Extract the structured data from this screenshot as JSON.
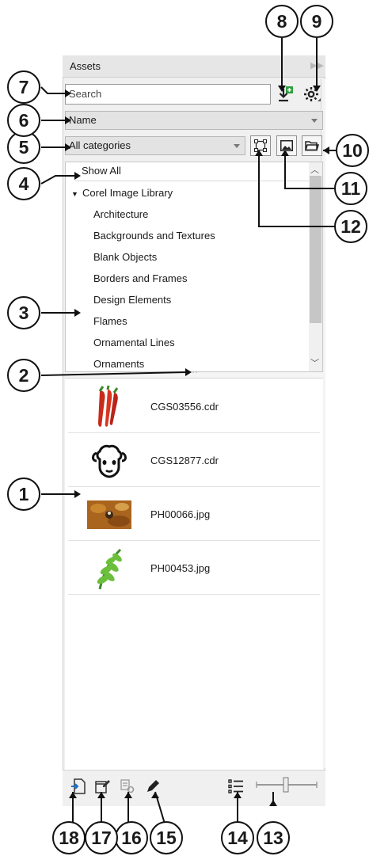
{
  "panel": {
    "title": "Assets",
    "search_placeholder": "Search",
    "sort_value": "Name",
    "category_value": "All categories"
  },
  "tree": {
    "show_all": "Show All",
    "library": "Corel Image Library",
    "items": [
      "Architecture",
      "Backgrounds and Textures",
      "Blank Objects",
      "Borders and Frames",
      "Design Elements",
      "Flames",
      "Ornamental Lines",
      "Ornaments"
    ]
  },
  "files": [
    {
      "name": "CGS03556.cdr",
      "thumb": "chili-peppers"
    },
    {
      "name": "CGS12877.cdr",
      "thumb": "sheep-face"
    },
    {
      "name": "PH00066.jpg",
      "thumb": "autumn-leaves-photo"
    },
    {
      "name": "PH00453.jpg",
      "thumb": "fern-leaves-photo"
    }
  ],
  "callouts": [
    "1",
    "2",
    "3",
    "4",
    "5",
    "6",
    "7",
    "8",
    "9",
    "10",
    "11",
    "12",
    "13",
    "14",
    "15",
    "16",
    "17",
    "18"
  ],
  "colors": {
    "accent": "#1c6fc7",
    "green_badge": "#2e9e3e"
  }
}
